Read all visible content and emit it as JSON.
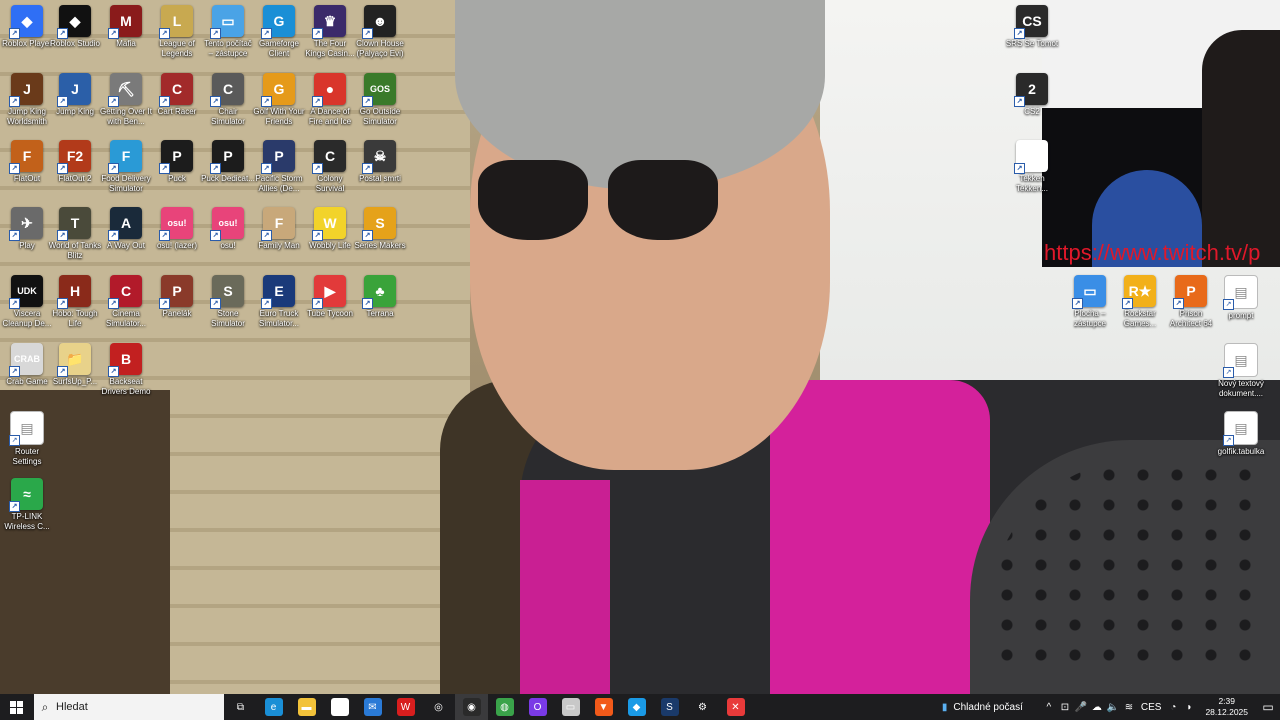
{
  "desktop": {
    "webcam_url": "https://www.twitch.tv/p",
    "icons": [
      {
        "id": "roblox-player",
        "label": "Roblox Player",
        "color": "#2f6ff5",
        "glyph": "◆"
      },
      {
        "id": "roblox-studio",
        "label": "Roblox Studio",
        "color": "#111111",
        "glyph": "◆"
      },
      {
        "id": "mafia",
        "label": "Mafia",
        "color": "#8a1b1b",
        "glyph": "M"
      },
      {
        "id": "league",
        "label": "League of Legends",
        "color": "#c8a950",
        "glyph": "L"
      },
      {
        "id": "tento-pocitac",
        "label": "Tento počítač – zástupce",
        "color": "#4aa3e6",
        "glyph": "▭"
      },
      {
        "id": "gameforge",
        "label": "Gameforge Client",
        "color": "#1a8fd6",
        "glyph": "G"
      },
      {
        "id": "four-kings",
        "label": "The Four Kings Casin...",
        "color": "#3b2a6a",
        "glyph": "♛"
      },
      {
        "id": "clown-house",
        "label": "Clown House (Palyaço Evi)",
        "color": "#222222",
        "glyph": "☻"
      },
      {
        "id": "jump-king-world",
        "label": "Jump King Worldsmith",
        "color": "#6a3a1a",
        "glyph": "J"
      },
      {
        "id": "jump-king",
        "label": "Jump King",
        "color": "#2b5fa8",
        "glyph": "J"
      },
      {
        "id": "getting-over-it",
        "label": "Getting Over It with Ben...",
        "color": "#7a7a7a",
        "glyph": "⛏"
      },
      {
        "id": "cart-racer",
        "label": "Cart Racer",
        "color": "#a22a2a",
        "glyph": "C"
      },
      {
        "id": "chair-sim",
        "label": "Chair Simulator",
        "color": "#5a5a5a",
        "glyph": "C"
      },
      {
        "id": "golf-friends",
        "label": "Golf With Your Friends",
        "color": "#e59a1a",
        "glyph": "G"
      },
      {
        "id": "dance-fire-ice",
        "label": "A Dance of Fire and Ice",
        "color": "#d9352b",
        "glyph": "●"
      },
      {
        "id": "go-outside",
        "label": "Go Outside Simulator",
        "color": "#3a7a2a",
        "glyph": "GOS"
      },
      {
        "id": "flatout",
        "label": "FlatOut",
        "color": "#c2611a",
        "glyph": "F"
      },
      {
        "id": "flatout2",
        "label": "FlatOut 2",
        "color": "#b23a1a",
        "glyph": "F2"
      },
      {
        "id": "food-delivery",
        "label": "Food Delivery Simulator",
        "color": "#2a9ad6",
        "glyph": "F"
      },
      {
        "id": "puck",
        "label": "Puck",
        "color": "#1c1c1c",
        "glyph": "P"
      },
      {
        "id": "puck-dedicated",
        "label": "Puck Dedicat...",
        "color": "#1c1c1c",
        "glyph": "P"
      },
      {
        "id": "pacific-storm",
        "label": "Pacific Storm Allies (De...",
        "color": "#2a3a6a",
        "glyph": "P"
      },
      {
        "id": "colony-survival",
        "label": "Colony Survival",
        "color": "#2a2a2a",
        "glyph": "C"
      },
      {
        "id": "postal",
        "label": "Postal smrti",
        "color": "#3a3a3a",
        "glyph": "☠"
      },
      {
        "id": "play",
        "label": "Play",
        "color": "#6a6a6a",
        "glyph": "✈"
      },
      {
        "id": "wot-blitz",
        "label": "World of Tanks Blitz",
        "color": "#4a4a3a",
        "glyph": "T"
      },
      {
        "id": "a-way-out",
        "label": "A Way Out",
        "color": "#1a2a3a",
        "glyph": "A"
      },
      {
        "id": "osu-lazer",
        "label": "osu! (lazer)",
        "color": "#e8447a",
        "glyph": "osu!"
      },
      {
        "id": "osu",
        "label": "osu!",
        "color": "#e8447a",
        "glyph": "osu!"
      },
      {
        "id": "family-man",
        "label": "Family Man",
        "color": "#c8a87a",
        "glyph": "F"
      },
      {
        "id": "wobbly-life",
        "label": "Wobbly Life",
        "color": "#f2d32a",
        "glyph": "W"
      },
      {
        "id": "series-makers",
        "label": "Series Makers",
        "color": "#e5a21a",
        "glyph": "S"
      },
      {
        "id": "viscera",
        "label": "Viscera Cleanup De...",
        "color": "#111111",
        "glyph": "UDK"
      },
      {
        "id": "hobo",
        "label": "Hobo: Tough Life",
        "color": "#8a2a1a",
        "glyph": "H"
      },
      {
        "id": "cinema-sim",
        "label": "Cinema Simulator...",
        "color": "#b21a2a",
        "glyph": "C"
      },
      {
        "id": "panelak",
        "label": "Panelák",
        "color": "#8a3a2a",
        "glyph": "P"
      },
      {
        "id": "stone-sim",
        "label": "Stone Simulator",
        "color": "#6a6a5a",
        "glyph": "S"
      },
      {
        "id": "euro-truck",
        "label": "Euro Truck Simulator...",
        "color": "#1a3a7a",
        "glyph": "E"
      },
      {
        "id": "tube-tycoon",
        "label": "Tube Tycoon",
        "color": "#e23a3a",
        "glyph": "▶"
      },
      {
        "id": "terrana",
        "label": "Terrana",
        "color": "#3aa33a",
        "glyph": "♣"
      },
      {
        "id": "crab-game",
        "label": "Crab Game",
        "color": "#d8d8d8",
        "glyph": "CRAB"
      },
      {
        "id": "surfsup",
        "label": "SurfsUp_P...",
        "color": "#e8d28a",
        "glyph": "📁"
      },
      {
        "id": "backseat",
        "label": "Backseat Drivers Demo",
        "color": "#c22020",
        "glyph": "B"
      },
      {
        "id": "router",
        "label": "Router Settings",
        "color": "#ffffff",
        "glyph": "▤"
      },
      {
        "id": "tp-link",
        "label": "TP-LINK Wireless C...",
        "color": "#2aa84a",
        "glyph": "≈"
      },
      {
        "id": "cs-left",
        "label": "SRS Se Tomot",
        "color": "#2a2a2a",
        "glyph": "CS"
      },
      {
        "id": "cs2",
        "label": "CS2",
        "color": "#2a2a2a",
        "glyph": "2"
      },
      {
        "id": "tekken",
        "label": "Tekken Tekken...",
        "color": "#ffffff",
        "glyph": "T"
      },
      {
        "id": "plocha",
        "label": "Plocha – zástupce",
        "color": "#3a8ee6",
        "glyph": "▭"
      },
      {
        "id": "rockstar",
        "label": "Rockstar Games...",
        "color": "#f2b01a",
        "glyph": "R★"
      },
      {
        "id": "prison-arch",
        "label": "Prison Architect 64",
        "color": "#e86a1a",
        "glyph": "P"
      },
      {
        "id": "prompt",
        "label": "prompt",
        "color": "#ffffff",
        "glyph": "▤"
      },
      {
        "id": "novy-textovy",
        "label": "Nový textový dokument....",
        "color": "#ffffff",
        "glyph": "▤"
      },
      {
        "id": "golfik",
        "label": "golfik.tabulka",
        "color": "#ffffff",
        "glyph": "▤"
      }
    ]
  },
  "taskbar": {
    "search_placeholder": "Hledat",
    "apps": [
      {
        "id": "task-view",
        "glyph": "⧉",
        "color": "transparent"
      },
      {
        "id": "edge",
        "glyph": "e",
        "color": "#1a8fd6"
      },
      {
        "id": "explorer",
        "glyph": "▬",
        "color": "#f2c23a"
      },
      {
        "id": "store",
        "glyph": "▦",
        "color": "#ffffff"
      },
      {
        "id": "mail",
        "glyph": "✉",
        "color": "#2a7ad6"
      },
      {
        "id": "wps",
        "glyph": "W",
        "color": "#d81e1e"
      },
      {
        "id": "steam-like",
        "glyph": "◎",
        "color": "transparent"
      },
      {
        "id": "obs",
        "glyph": "◉",
        "color": "#2a2a2a"
      },
      {
        "id": "chrome",
        "glyph": "◍",
        "color": "#3aa34a"
      },
      {
        "id": "opera",
        "glyph": "O",
        "color": "#7a3ae6"
      },
      {
        "id": "files",
        "glyph": "▭",
        "color": "#c8c8c8"
      },
      {
        "id": "brave",
        "glyph": "▼",
        "color": "#f25a1a"
      },
      {
        "id": "vscode-like",
        "glyph": "◆",
        "color": "#1a9ae6"
      },
      {
        "id": "steam",
        "glyph": "S",
        "color": "#1a3a6a"
      },
      {
        "id": "settings",
        "glyph": "⚙",
        "color": "transparent"
      },
      {
        "id": "capcut",
        "glyph": "✕",
        "color": "#e83a3a"
      }
    ],
    "active_app": "obs",
    "weather_text": "Chladné počasí",
    "tray_glyphs": [
      "^",
      "⊡",
      "🎤",
      "☁",
      "🔈",
      "≋"
    ],
    "language": "CES",
    "time": "2:39",
    "date": "28.12.2025"
  }
}
